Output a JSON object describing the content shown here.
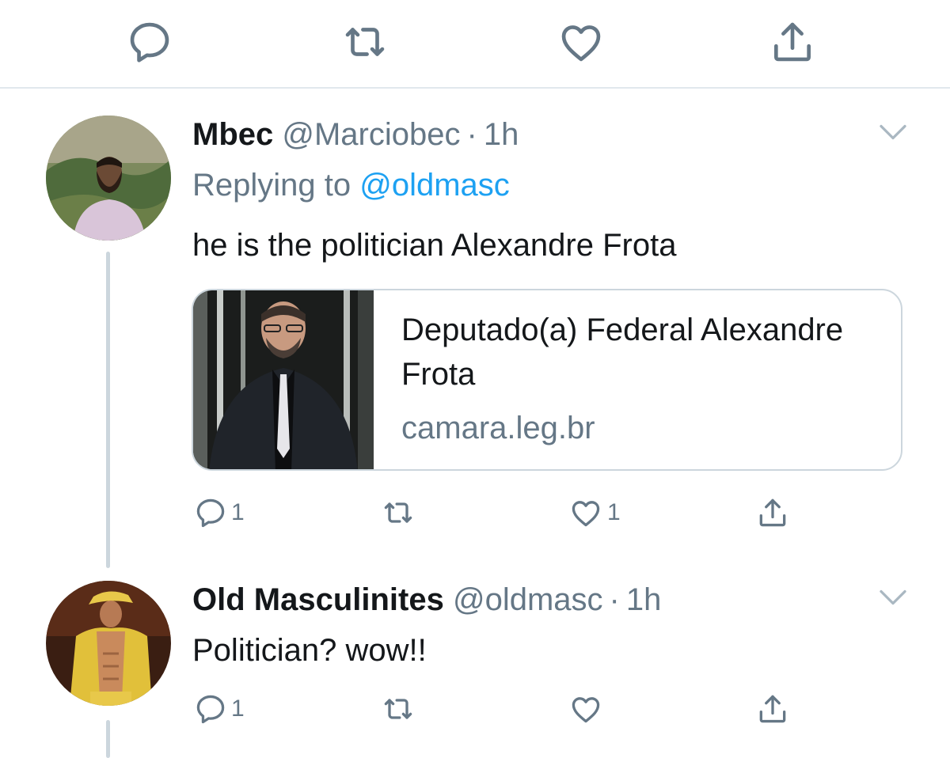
{
  "top_actions": {
    "reply_icon": "reply-icon",
    "retweet_icon": "retweet-icon",
    "like_icon": "like-icon",
    "share_icon": "share-icon"
  },
  "tweets": [
    {
      "name": "Mbec",
      "handle": "@Marciobec",
      "separator": "·",
      "time": "1h",
      "replying_prefix": "Replying to",
      "replying_to": "@oldmasc",
      "text": "he is the politician Alexandre Frota",
      "card": {
        "title": "Deputado(a) Federal Alexandre Frota",
        "domain": "camara.leg.br"
      },
      "reply_count": "1",
      "retweet_count": "",
      "like_count": "1"
    },
    {
      "name": "Old Masculinites",
      "handle": "@oldmasc",
      "separator": "·",
      "time": "1h",
      "text": "Politician? wow!!",
      "reply_count": "1",
      "retweet_count": "",
      "like_count": ""
    }
  ],
  "colors": {
    "text": "#14171a",
    "secondary": "#657786",
    "link": "#1da1f2",
    "border": "#ccd6dd"
  }
}
